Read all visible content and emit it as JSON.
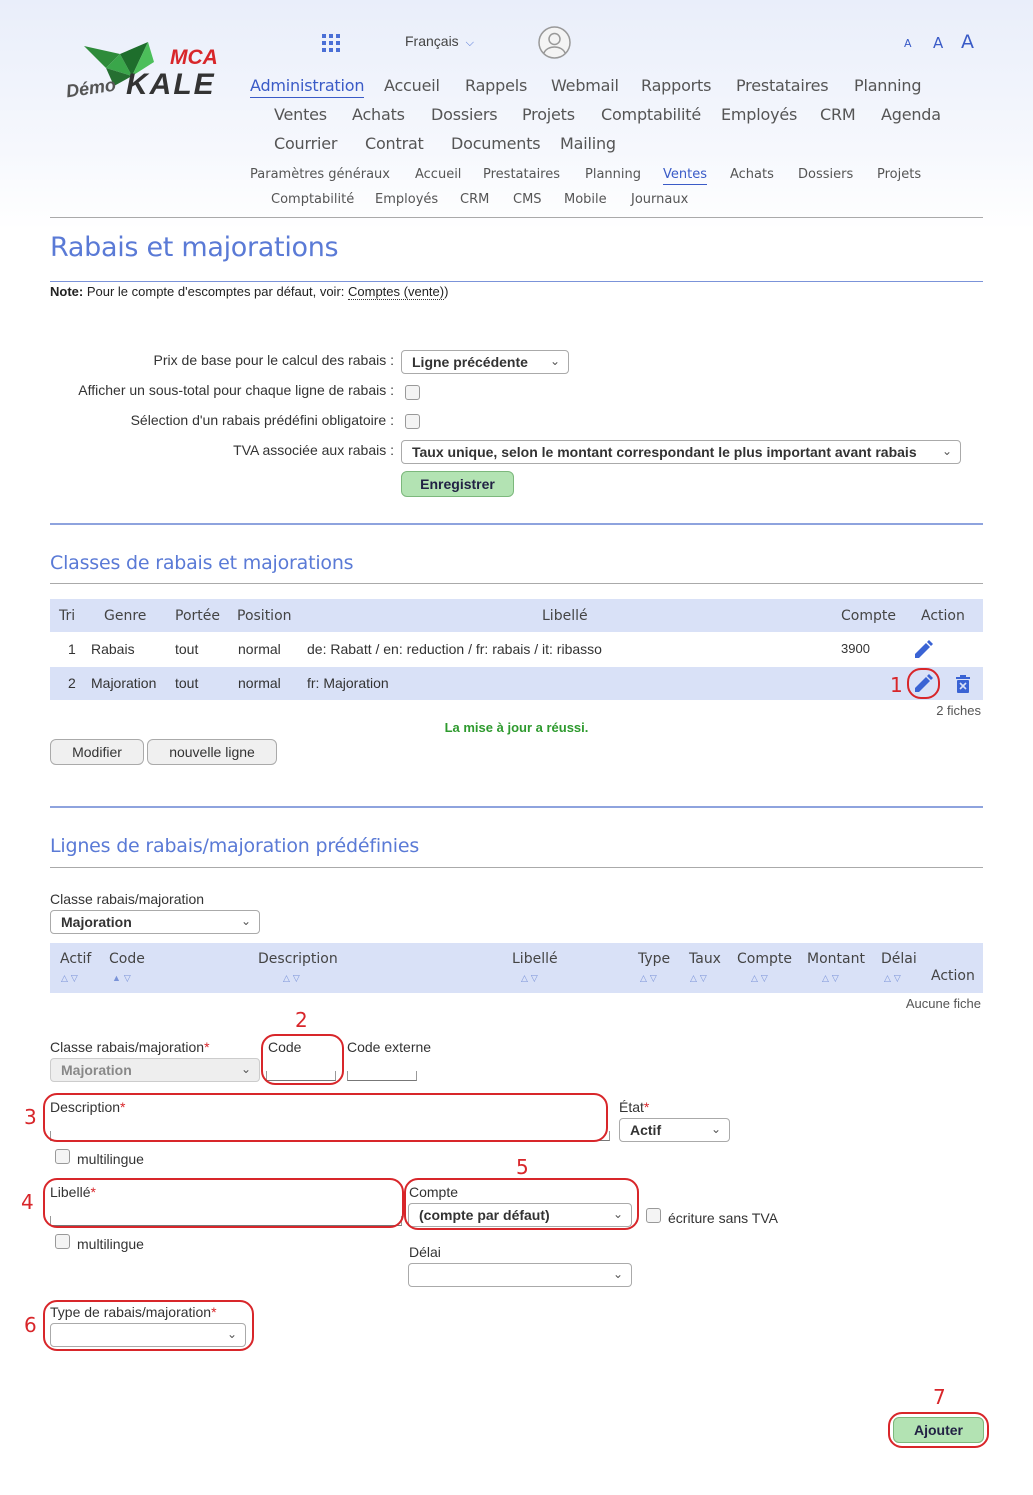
{
  "logo": {
    "demo": "Démo",
    "brand": "KALE",
    "mca": "MCA"
  },
  "header": {
    "language": "Français",
    "font_sizes": [
      "A",
      "A",
      "A"
    ]
  },
  "nav_main": [
    "Administration",
    "Accueil",
    "Rappels",
    "Webmail",
    "Rapports",
    "Prestataires",
    "Planning",
    "Ventes",
    "Achats",
    "Dossiers",
    "Projets",
    "Comptabilité",
    "Employés",
    "CRM",
    "Agenda",
    "Courrier",
    "Contrat",
    "Documents",
    "Mailing"
  ],
  "nav_sub": [
    "Paramètres généraux",
    "Accueil",
    "Prestataires",
    "Planning",
    "Ventes",
    "Achats",
    "Dossiers",
    "Projets",
    "Comptabilité",
    "Employés",
    "CRM",
    "CMS",
    "Mobile",
    "Journaux"
  ],
  "page": {
    "title": "Rabais et majorations",
    "note_label": "Note:",
    "note_text": " Pour le compte d'escomptes par défaut, voir: ",
    "note_link": "Comptes (vente)",
    "note_end": ")"
  },
  "settings": {
    "base_price_label": "Prix de base pour le calcul des rabais :",
    "base_price_value": "Ligne précédente",
    "subtotal_label": "Afficher un sous-total pour chaque ligne de rabais :",
    "predefined_label": "Sélection d'un rabais prédéfini obligatoire :",
    "vat_label": "TVA associée aux rabais :",
    "vat_value": "Taux unique, selon le montant correspondant le plus important avant rabais",
    "save_label": "Enregistrer"
  },
  "classes": {
    "title": "Classes de rabais et majorations",
    "columns": [
      "Tri",
      "Genre",
      "Portée",
      "Position",
      "Libellé",
      "Compte",
      "Action"
    ],
    "rows": [
      {
        "tri": "1",
        "genre": "Rabais",
        "portee": "tout",
        "position": "normal",
        "libelle": "de: Rabatt / en: reduction / fr: rabais / it: ribasso",
        "compte": "3900"
      },
      {
        "tri": "2",
        "genre": "Majoration",
        "portee": "tout",
        "position": "normal",
        "libelle": "fr: Majoration",
        "compte": ""
      }
    ],
    "count": "2 fiches",
    "success": "La mise à jour a réussi.",
    "modify_label": "Modifier",
    "new_line_label": "nouvelle ligne"
  },
  "lines": {
    "title": "Lignes de rabais/majoration prédéfinies",
    "class_label": "Classe rabais/majoration",
    "class_value": "Majoration",
    "columns": [
      "Actif",
      "Code",
      "Description",
      "Libellé",
      "Type",
      "Taux",
      "Compte",
      "Montant",
      "Délai",
      "Action"
    ],
    "empty": "Aucune fiche"
  },
  "form": {
    "class_label": "Classe rabais/majoration",
    "class_value": "Majoration",
    "code_label": "Code",
    "ext_code_label": "Code externe",
    "description_label": "Description",
    "state_label": "État",
    "state_value": "Actif",
    "multilingual_label": "multilingue",
    "libelle_label": "Libellé",
    "account_label": "Compte",
    "account_value": "(compte par défaut)",
    "no_vat_label": "écriture sans TVA",
    "delay_label": "Délai",
    "type_label": "Type de rabais/majoration",
    "required_mark": "*",
    "add_label": "Ajouter"
  },
  "annotations": [
    "1",
    "2",
    "3",
    "4",
    "5",
    "6",
    "7"
  ],
  "colors": {
    "accent": "#5a7ad6",
    "annotation": "#d8262a",
    "success": "#2e9a2e",
    "button_green": "#b3e3b3"
  }
}
